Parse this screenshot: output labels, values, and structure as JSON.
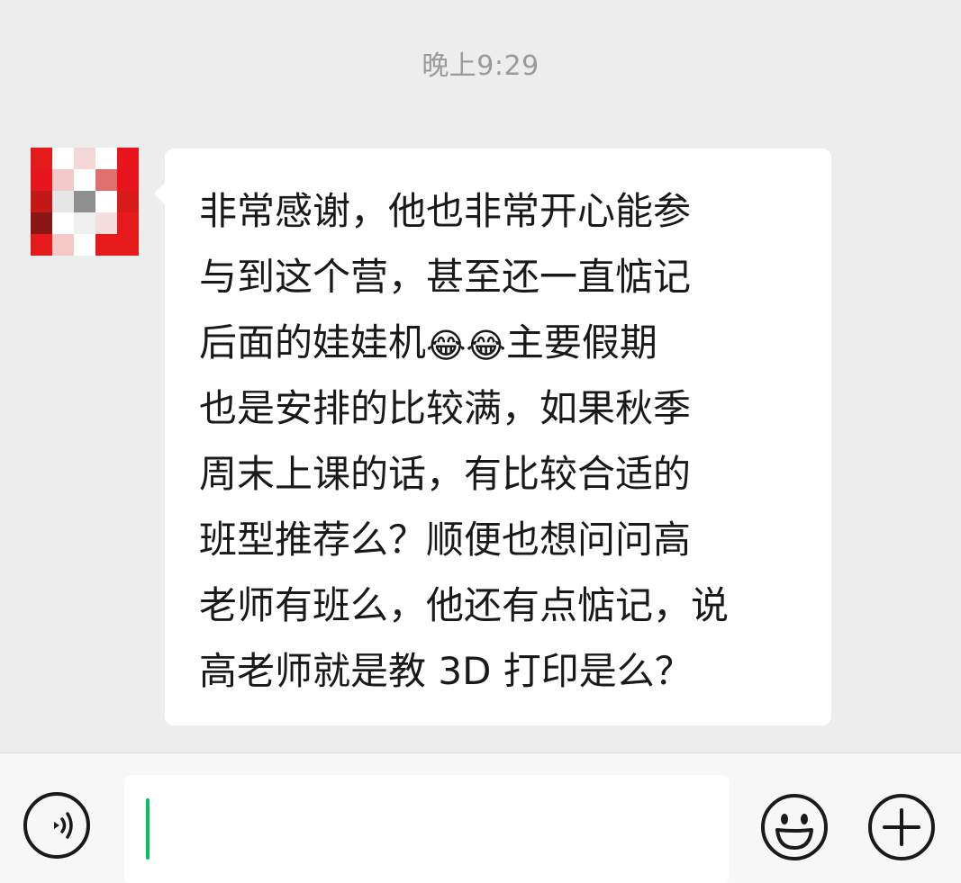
{
  "timestamp": "晚上9:29",
  "contact": {
    "avatar_icon": "pixelated-avatar"
  },
  "message": {
    "lines": [
      {
        "text": "非常感谢，他也非常开心能参"
      },
      {
        "text": "与到这个营，甚至还一直惦记"
      },
      {
        "pre": "后面的娃娃机",
        "emoji": "😂😂",
        "post": "主要假期"
      },
      {
        "text": "也是安排的比较满，如果秋季"
      },
      {
        "text": "周末上课的话，有比较合适的"
      },
      {
        "text": "班型推荐么？顺便也想问问高"
      },
      {
        "text": "老师有班么，他还有点惦记，说"
      },
      {
        "text": "高老师就是教 3D 打印是么？"
      }
    ]
  },
  "input_bar": {
    "voice_icon": "voice-input-icon",
    "input_value": "",
    "emoji_icon": "emoji-smile-icon",
    "plus_icon": "plus-more-icon",
    "caret_color": "#07c160"
  }
}
